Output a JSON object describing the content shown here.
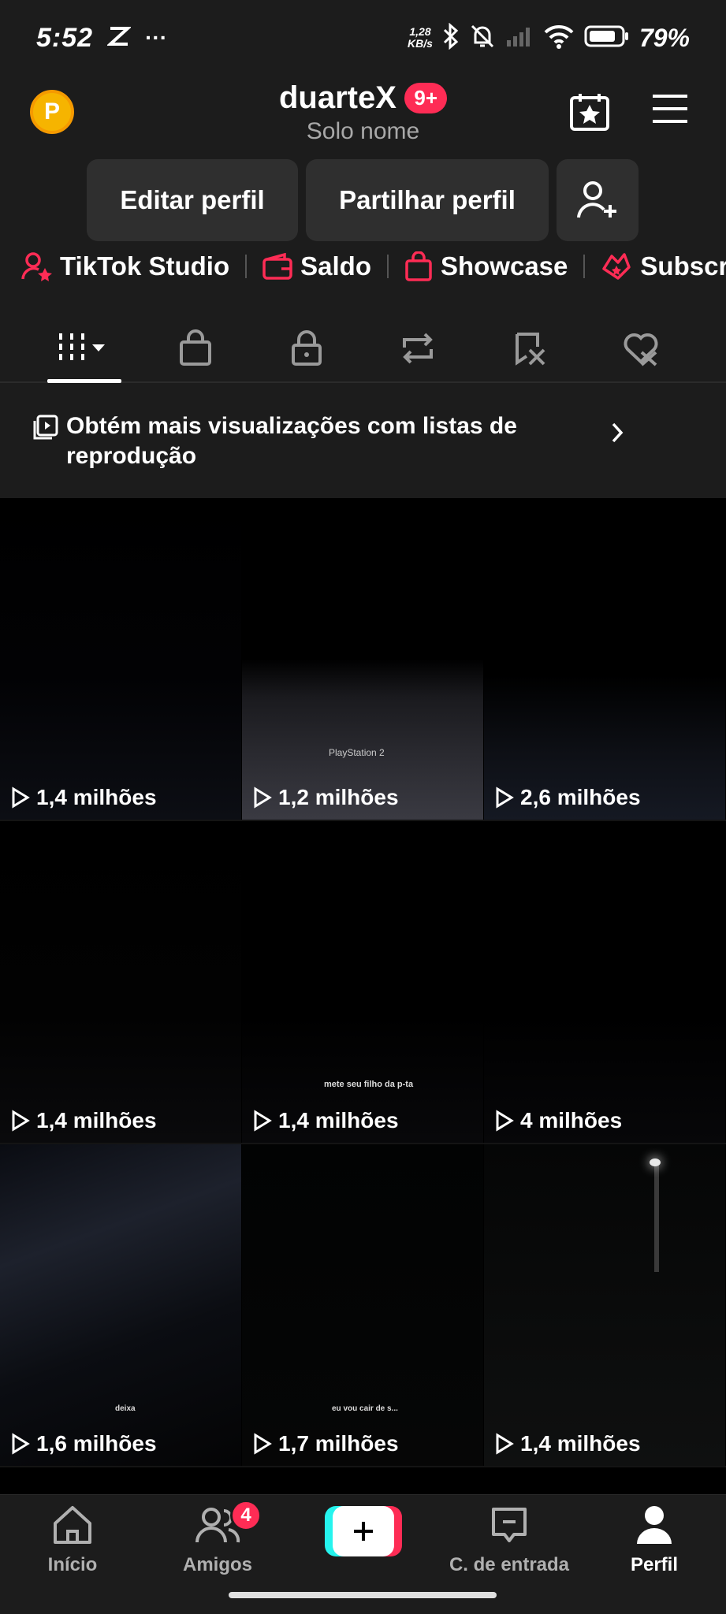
{
  "status_bar": {
    "time": "5:52",
    "net_speed_value": "1,28",
    "net_speed_unit": "KB/s",
    "battery": "79%"
  },
  "header": {
    "username": "duarteX",
    "notification_badge": "9+",
    "subtitle": "Solo nome"
  },
  "actions": {
    "edit_profile": "Editar perfil",
    "share_profile": "Partilhar perfil"
  },
  "shortcuts": [
    {
      "label": "TikTok Studio",
      "icon": "person-star-icon"
    },
    {
      "label": "Saldo",
      "icon": "wallet-icon"
    },
    {
      "label": "Showcase",
      "icon": "bag-icon"
    },
    {
      "label": "Subscriç",
      "icon": "subscription-icon"
    }
  ],
  "tabs": [
    {
      "icon": "videos-grid-icon",
      "active": true
    },
    {
      "icon": "shop-bag-icon"
    },
    {
      "icon": "lock-icon"
    },
    {
      "icon": "repost-icon"
    },
    {
      "icon": "saved-icon"
    },
    {
      "icon": "liked-icon"
    }
  ],
  "banner": {
    "text": "Obtém mais visualizações com listas de reprodução"
  },
  "videos": [
    {
      "views": "1,4 milhões"
    },
    {
      "views": "1,2 milhões"
    },
    {
      "views": "2,6 milhões"
    },
    {
      "views": "1,4 milhões"
    },
    {
      "views": "1,4 milhões"
    },
    {
      "views": "4 milhões"
    },
    {
      "views": "1,6 milhões"
    },
    {
      "views": "1,7 milhões"
    },
    {
      "views": "1,4 milhões"
    }
  ],
  "thumbnail_texts": {
    "ps2": "PlayStation 2",
    "caption_5": "mete seu filho da p-ta",
    "caption_7": "deixa",
    "caption_8": "eu vou cair de s..."
  },
  "nav": {
    "home": "Início",
    "friends": "Amigos",
    "friends_badge": "4",
    "inbox": "C. de entrada",
    "profile": "Perfil"
  },
  "colors": {
    "accent": "#fe2c55",
    "teal": "#25f4ee",
    "coin": "#f6b400",
    "background": "#1c1c1c"
  }
}
